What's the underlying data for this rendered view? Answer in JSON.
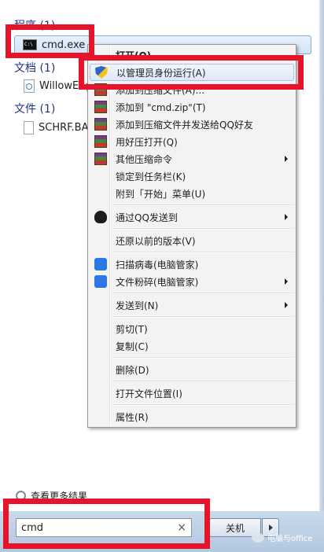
{
  "groups": {
    "programs": {
      "header": "程序 (1)",
      "item": "cmd.exe"
    },
    "documents": {
      "header": "文档 (1)",
      "item": "WillowEng"
    },
    "files": {
      "header": "文件 (1)",
      "item": "SCHRF.BAS"
    }
  },
  "context_menu": {
    "items": {
      "open": "打开(O)",
      "run_as_admin": "以管理员身份运行(A)",
      "add_to_archive": "添加到压缩文件(A)...",
      "add_to_zip": "添加到 \"cmd.zip\"(T)",
      "add_and_send_qq": "添加到压缩文件并发送给QQ好友",
      "open_with_haozip": "用好压打开(Q)",
      "other_compress": "其他压缩命令",
      "pin_taskbar": "锁定到任务栏(K)",
      "pin_start": "附到「开始」菜单(U)",
      "send_via_qq": "通过QQ发送到",
      "restore_versions": "还原以前的版本(V)",
      "scan_virus": "扫描病毒(电脑管家)",
      "shred_file": "文件粉碎(电脑管家)",
      "send_to": "发送到(N)",
      "cut": "剪切(T)",
      "copy": "复制(C)",
      "delete": "删除(D)",
      "open_location": "打开文件位置(I)",
      "properties": "属性(R)"
    }
  },
  "see_more": "查看更多结果",
  "search": {
    "value": "cmd",
    "clear_glyph": "×"
  },
  "shutdown": {
    "label": "关机"
  },
  "watermark": "电脑与office",
  "colors": {
    "accent_red": "#e5142b",
    "group_header": "#1e3287"
  }
}
